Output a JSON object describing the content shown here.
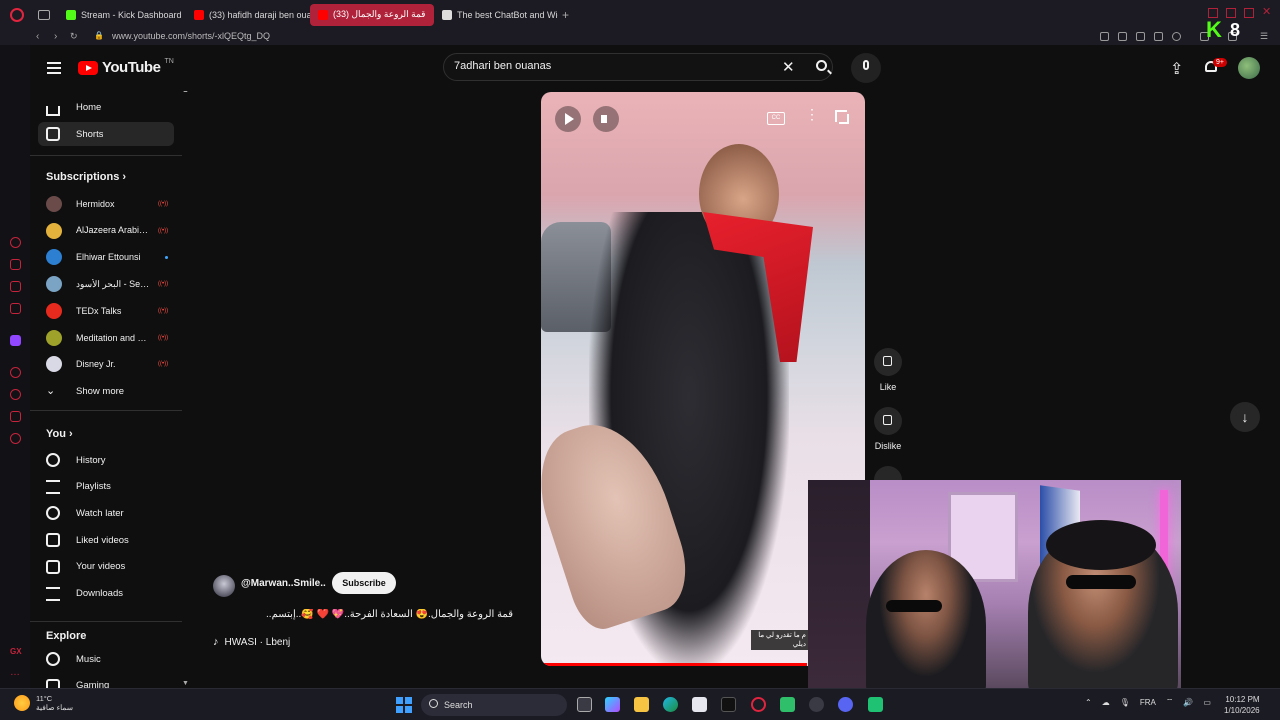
{
  "browser": {
    "tabs": [
      {
        "label": "Stream - Kick Dashboard",
        "color": "#53fc18"
      },
      {
        "label": "(33) hafidh daraji ben ouanas",
        "color": "#ff0000"
      },
      {
        "label": "(33) قمة الروعة والجمال",
        "color": "#ff0000",
        "active": true
      },
      {
        "label": "The best ChatBot and Widgets",
        "color": "#dddddd"
      }
    ],
    "url": "www.youtube.com/shorts/-xlQEQtg_DQ",
    "new_tab": "+"
  },
  "kick_overlay": {
    "logo": "K",
    "count": "8"
  },
  "youtube": {
    "logo_text": "YouTube",
    "logo_tm": "TN",
    "search": {
      "value": "7adhari ben ouanas",
      "placeholder": "Search"
    },
    "notification_badge": "9+",
    "nav": [
      {
        "label": "Home",
        "icon": "home-icon"
      },
      {
        "label": "Shorts",
        "icon": "shorts-icon",
        "active": true
      }
    ],
    "subscriptions_title": "Subscriptions",
    "subscriptions": [
      {
        "name": "Hermidox",
        "indicator": "live",
        "avatar_color": "#6b4a4a"
      },
      {
        "name": "AlJazeera Arabic قناة الجزيرة",
        "indicator": "live",
        "avatar_color": "#e3b23c"
      },
      {
        "name": "Elhiwar Ettounsi",
        "indicator": "new",
        "avatar_color": "#2d7fd1"
      },
      {
        "name": "البحر الأسود - Sen A...",
        "indicator": "live",
        "avatar_color": "#7aa3c4"
      },
      {
        "name": "TEDx Talks",
        "indicator": "live",
        "avatar_color": "#e62b1e"
      },
      {
        "name": "Meditation and Healing",
        "indicator": "live",
        "avatar_color": "#9ea22a"
      },
      {
        "name": "Disney Jr.",
        "indicator": "live",
        "avatar_color": "#d9d9e6"
      }
    ],
    "show_more": "Show more",
    "you_title": "You",
    "you_items": [
      {
        "label": "History",
        "icon": "history-icon"
      },
      {
        "label": "Playlists",
        "icon": "playlists-icon"
      },
      {
        "label": "Watch later",
        "icon": "watch-later-icon"
      },
      {
        "label": "Liked videos",
        "icon": "liked-videos-icon"
      },
      {
        "label": "Your videos",
        "icon": "your-videos-icon"
      },
      {
        "label": "Downloads",
        "icon": "downloads-icon"
      }
    ],
    "explore_title": "Explore",
    "explore_items": [
      {
        "label": "Music",
        "icon": "music-icon"
      },
      {
        "label": "Gaming",
        "icon": "gaming-icon"
      }
    ],
    "short": {
      "channel": "@Marwan..Smile..",
      "subscribe": "Subscribe",
      "title": "قمة الروعة والجمال.😍 السعادة الفرحة..💖 ❤️ 🥰..إبتسم..",
      "music": "HWASI · Lbenj",
      "like_label": "Like",
      "dislike_label": "Dislike",
      "caption": "م ما تقدرو لي ما ديلي",
      "progress": 0.82
    }
  },
  "taskbar": {
    "weather_temp": "11°C",
    "weather_desc": "سماء صافية",
    "search_label": "Search",
    "lang": "FRA",
    "time": "10:12 PM",
    "date": "1/10/2026"
  }
}
